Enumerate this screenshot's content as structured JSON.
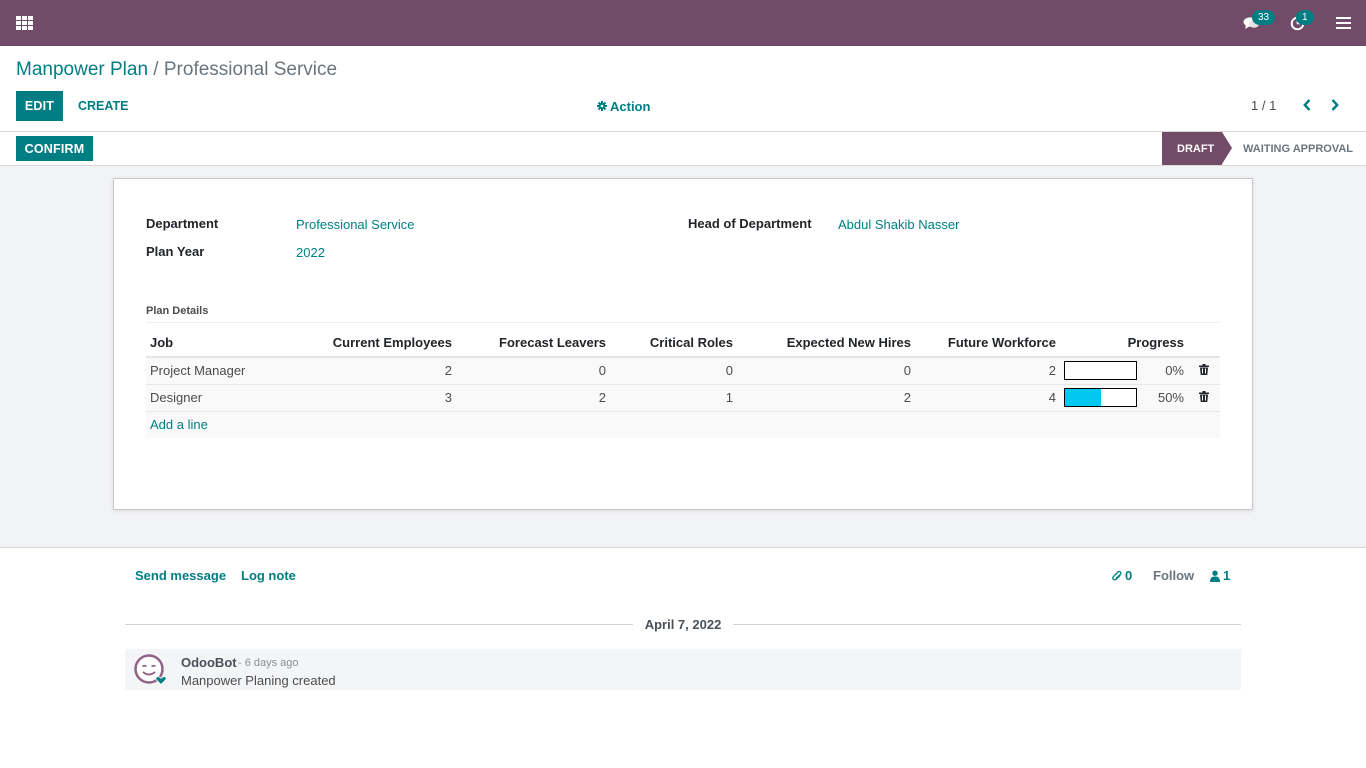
{
  "navbar": {
    "apps_icon": "apps-grid-icon",
    "messages_badge": "33",
    "activities_badge": "1",
    "menu_icon": "hamburger-icon"
  },
  "breadcrumb": {
    "parent": "Manpower Plan",
    "separator": " / ",
    "current": "Professional Service"
  },
  "toolbar": {
    "edit_label": "EDIT",
    "create_label": "CREATE",
    "action_label": "Action",
    "pager": "1 / 1"
  },
  "statusbar": {
    "confirm_label": "CONFIRM",
    "stages": [
      {
        "label": "DRAFT",
        "active": true
      },
      {
        "label": "WAITING APPROVAL",
        "active": false
      }
    ]
  },
  "form": {
    "department_label": "Department",
    "department_value": "Professional Service",
    "plan_year_label": "Plan Year",
    "plan_year_value": "2022",
    "head_label": "Head of Department",
    "head_value": "Abdul Shakib Nasser",
    "section_title": "Plan Details",
    "table": {
      "columns": [
        "Job",
        "Current Employees",
        "Forecast Leavers",
        "Critical Roles",
        "Expected New Hires",
        "Future Workforce",
        "Progress"
      ],
      "rows": [
        {
          "job": "Project Manager",
          "current": "2",
          "leavers": "0",
          "critical": "0",
          "new_hires": "0",
          "future": "2",
          "progress": 0,
          "progress_label": "0%"
        },
        {
          "job": "Designer",
          "current": "3",
          "leavers": "2",
          "critical": "1",
          "new_hires": "2",
          "future": "4",
          "progress": 50,
          "progress_label": "50%"
        }
      ],
      "add_line_label": "Add a line"
    }
  },
  "chatter": {
    "send_message_label": "Send message",
    "log_note_label": "Log note",
    "attachments_count": "0",
    "follow_label": "Follow",
    "followers_count": "1",
    "date_separator": "April 7, 2022",
    "messages": [
      {
        "author": "OdooBot",
        "date": "- 6 days ago",
        "body": "Manpower Planing created"
      }
    ]
  },
  "colors": {
    "brand": "#714b67",
    "accent": "#017e84",
    "progress_fill": "#00c8f0"
  }
}
